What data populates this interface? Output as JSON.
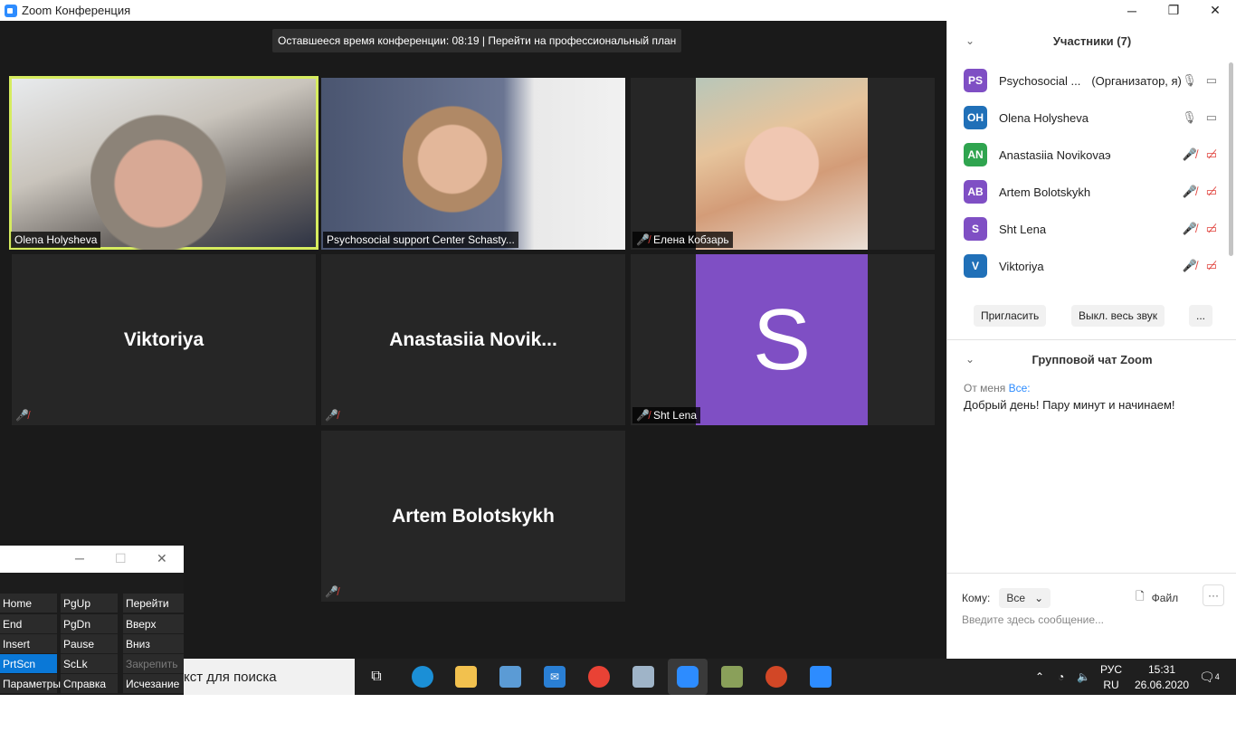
{
  "window": {
    "title": "Zoom Конференция",
    "minimize": "─",
    "restore": "❐",
    "close": "✕"
  },
  "banner": "Оставшееся время конференции: 08:19 | Перейти на профессиональный план",
  "tiles": {
    "olena": "Olena Holysheva",
    "psych": "Psychosocial support Center Schasty...",
    "elena": "Елена Кобзарь",
    "viktoriya": "Viktoriya",
    "anastasiia": "Anastasiia  Novik...",
    "sht": "Sht Lena",
    "artem": "Artem Bolotskykh",
    "s_letter": "S"
  },
  "participants": {
    "header": "Участники (7)",
    "items": [
      {
        "initials": "PS",
        "name": "Psychosocial ...",
        "role": "(Организатор, я)",
        "color": "#7f4fc4"
      },
      {
        "initials": "OH",
        "name": "Olena Holysheva",
        "role": "",
        "color": "#2070b8"
      },
      {
        "initials": "AN",
        "name": "Anastasiia Novikovaэ",
        "role": "",
        "color": "#2fa44f"
      },
      {
        "initials": "AB",
        "name": "Artem Bolotskykh",
        "role": "",
        "color": "#7f4fc4"
      },
      {
        "initials": "S",
        "name": "Sht Lena",
        "role": "",
        "color": "#7f4fc4"
      },
      {
        "initials": "V",
        "name": "Viktoriya",
        "role": "",
        "color": "#2070b8"
      }
    ],
    "invite": "Пригласить",
    "mute_all": "Выкл. весь звук",
    "more": "..."
  },
  "chat": {
    "header": "Групповой чат Zoom",
    "from": "От меня",
    "to": "Все:",
    "message": "Добрый день! Пару минут и начинаем!",
    "to_label": "Кому:",
    "to_value": "Все",
    "file": "Файл",
    "placeholder": "Введите здесь сообщение..."
  },
  "taskbar": {
    "search": "кст для поиска",
    "lang_top": "РУС",
    "lang_bottom": "RU",
    "time": "15:31",
    "date": "26.06.2020",
    "notifications": "4"
  },
  "osk": {
    "keys": [
      [
        "Home",
        "PgUp",
        "Перейти"
      ],
      [
        "End",
        "PgDn",
        "Вверх"
      ],
      [
        "Insert",
        "Pause",
        "Вниз"
      ],
      [
        "PrtScn",
        "ScLk",
        "Закрепить"
      ],
      [
        "Параметры",
        "Справка",
        "Исчезание"
      ]
    ]
  }
}
